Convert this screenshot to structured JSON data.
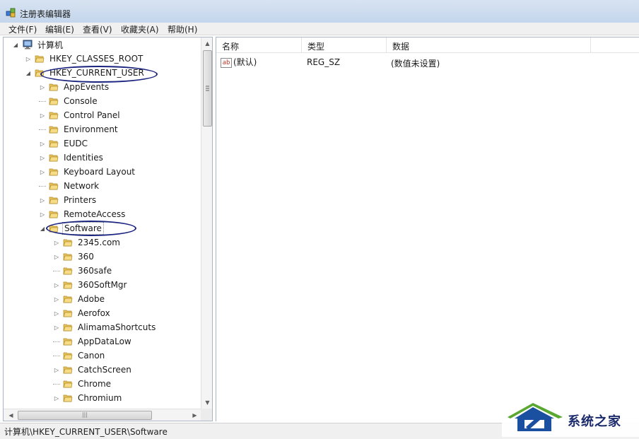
{
  "window": {
    "title": "注册表编辑器"
  },
  "menu": {
    "items": [
      "文件(F)",
      "编辑(E)",
      "查看(V)",
      "收藏夹(A)",
      "帮助(H)"
    ]
  },
  "tree": {
    "root": "计算机",
    "nodes": [
      {
        "label": "HKEY_CLASSES_ROOT",
        "level": 1,
        "expander": "collapsed"
      },
      {
        "label": "HKEY_CURRENT_USER",
        "level": 1,
        "expander": "expanded"
      },
      {
        "label": "AppEvents",
        "level": 2,
        "expander": "collapsed"
      },
      {
        "label": "Console",
        "level": 2,
        "expander": "none"
      },
      {
        "label": "Control Panel",
        "level": 2,
        "expander": "collapsed"
      },
      {
        "label": "Environment",
        "level": 2,
        "expander": "none"
      },
      {
        "label": "EUDC",
        "level": 2,
        "expander": "collapsed"
      },
      {
        "label": "Identities",
        "level": 2,
        "expander": "collapsed"
      },
      {
        "label": "Keyboard Layout",
        "level": 2,
        "expander": "collapsed"
      },
      {
        "label": "Network",
        "level": 2,
        "expander": "none"
      },
      {
        "label": "Printers",
        "level": 2,
        "expander": "collapsed"
      },
      {
        "label": "RemoteAccess",
        "level": 2,
        "expander": "collapsed"
      },
      {
        "label": "Software",
        "level": 2,
        "expander": "expanded",
        "selected": true
      },
      {
        "label": "2345.com",
        "level": 3,
        "expander": "collapsed"
      },
      {
        "label": "360",
        "level": 3,
        "expander": "collapsed"
      },
      {
        "label": "360safe",
        "level": 3,
        "expander": "none"
      },
      {
        "label": "360SoftMgr",
        "level": 3,
        "expander": "collapsed"
      },
      {
        "label": "Adobe",
        "level": 3,
        "expander": "collapsed"
      },
      {
        "label": "Aerofox",
        "level": 3,
        "expander": "collapsed"
      },
      {
        "label": "AlimamaShortcuts",
        "level": 3,
        "expander": "collapsed"
      },
      {
        "label": "AppDataLow",
        "level": 3,
        "expander": "none"
      },
      {
        "label": "Canon",
        "level": 3,
        "expander": "none"
      },
      {
        "label": "CatchScreen",
        "level": 3,
        "expander": "collapsed"
      },
      {
        "label": "Chrome",
        "level": 3,
        "expander": "none"
      },
      {
        "label": "Chromium",
        "level": 3,
        "expander": "collapsed"
      }
    ]
  },
  "values": {
    "columns": [
      "名称",
      "类型",
      "数据"
    ],
    "rows": [
      {
        "name": "(默认)",
        "type": "REG_SZ",
        "data": "(数值未设置)",
        "icon": "ab-string-icon"
      }
    ]
  },
  "status": {
    "path": "计算机\\HKEY_CURRENT_USER\\Software"
  },
  "watermark": {
    "text": "系统之家"
  },
  "colors": {
    "annotation_ellipse": "#1a237e",
    "folder": "#e8c45a",
    "titlebar": "#c9daee"
  }
}
